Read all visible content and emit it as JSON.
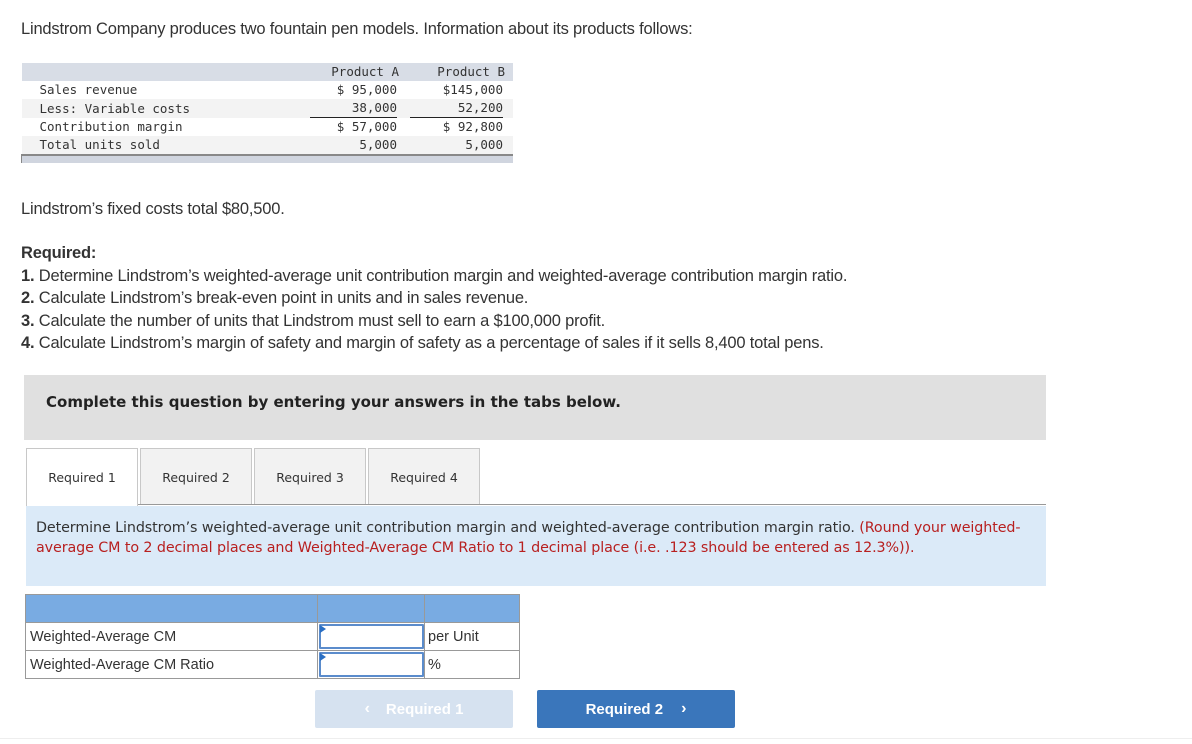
{
  "intro_text": "Lindstrom Company produces two fountain pen models. Information about its products follows:",
  "product_table": {
    "columns": [
      "",
      "Product A",
      "Product B"
    ],
    "rows": [
      {
        "label": "Sales revenue",
        "a": "$ 95,000",
        "b": "$145,000"
      },
      {
        "label": "Less: Variable costs",
        "a": "38,000",
        "b": "52,200"
      },
      {
        "label": "Contribution margin",
        "a": "$ 57,000",
        "b": "$ 92,800"
      },
      {
        "label": "Total units sold",
        "a": "5,000",
        "b": "5,000"
      }
    ]
  },
  "fixed_costs_text": "Lindstrom’s fixed costs total $80,500.",
  "required": {
    "heading": "Required:",
    "items": [
      {
        "num": "1.",
        "text": " Determine Lindstrom’s weighted-average unit contribution margin and weighted-average contribution margin ratio."
      },
      {
        "num": "2.",
        "text": " Calculate Lindstrom’s break-even point in units and in sales revenue."
      },
      {
        "num": "3.",
        "text": " Calculate the number of units that Lindstrom must sell to earn a $100,000 profit."
      },
      {
        "num": "4.",
        "text": " Calculate Lindstrom’s margin of safety and margin of safety as a percentage of sales if it sells 8,400 total pens."
      }
    ]
  },
  "instruction_banner": "Complete this question by entering your answers in the tabs below.",
  "tabs": [
    {
      "label": "Required 1",
      "active": true
    },
    {
      "label": "Required 2",
      "active": false
    },
    {
      "label": "Required 3",
      "active": false
    },
    {
      "label": "Required 4",
      "active": false
    }
  ],
  "question": {
    "text": "Determine Lindstrom’s weighted-average unit contribution margin and weighted-average contribution margin ratio. ",
    "note": "(Round your weighted-average CM to 2 decimal places and Weighted-Average CM Ratio to 1 decimal place (i.e. .123 should be entered as 12.3%))."
  },
  "answer_table": {
    "rows": [
      {
        "label": "Weighted-Average CM",
        "value": "",
        "unit": "per Unit"
      },
      {
        "label": "Weighted-Average CM Ratio",
        "value": "",
        "unit": "%"
      }
    ]
  },
  "navigation": {
    "prev_label": "Required 1",
    "next_label": "Required 2",
    "prev_icon": "‹",
    "next_icon": "›"
  }
}
